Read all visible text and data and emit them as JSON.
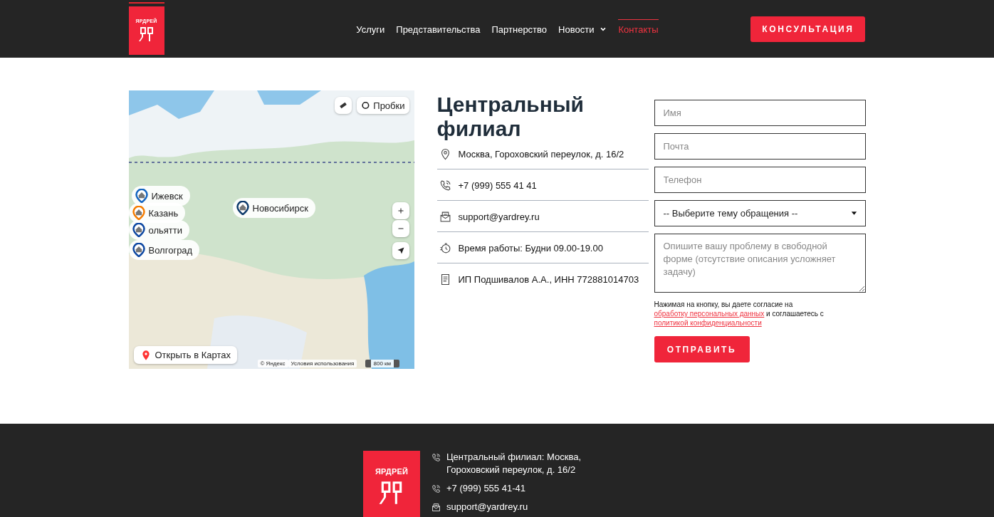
{
  "header": {
    "logo": {
      "text": "ЯРДРЕЙ"
    },
    "nav": [
      {
        "label": "Услуги",
        "selected": false,
        "kind": "link"
      },
      {
        "label": "Представительства",
        "selected": false,
        "kind": "link"
      },
      {
        "label": "Партнерство",
        "selected": false,
        "kind": "link"
      },
      {
        "label": "Новости",
        "selected": false,
        "kind": "dropdown"
      },
      {
        "label": "Контакты",
        "selected": true,
        "kind": "link"
      }
    ],
    "cta": "КОНСУЛЬТАЦИЯ"
  },
  "map": {
    "traffic_button": "Пробки",
    "open_button": "Открыть в Картах",
    "copyright": "© Яндекс",
    "terms": "Условия использования",
    "scale": "800 км",
    "pins": [
      {
        "label": "Ижевск",
        "color": "#1565c0"
      },
      {
        "label": "Казань",
        "color": "#f57c00"
      },
      {
        "label": "ольятти",
        "color": "#0d47a1"
      },
      {
        "label": "Волгоград",
        "color": "#0d47a1"
      },
      {
        "label": "Новосибирск",
        "color": "#0d3a6b"
      }
    ]
  },
  "branch": {
    "title": "Центральный филиал",
    "rows": [
      {
        "kind": "address",
        "text": "Москва, Гороховский переулок, д. 16/2"
      },
      {
        "kind": "phone",
        "text": "+7 (999) 555 41 41"
      },
      {
        "kind": "email",
        "text": "support@yardrey.ru"
      },
      {
        "kind": "hours",
        "text": "Время работы: Будни 09.00-19.00"
      },
      {
        "kind": "document",
        "text": "ИП Подшивалов А.А., ИНН 772881014703"
      }
    ]
  },
  "form": {
    "fields": [
      {
        "kind": "input",
        "placeholder": "Имя"
      },
      {
        "kind": "input",
        "placeholder": "Почта"
      },
      {
        "kind": "input",
        "placeholder": "Телефон"
      },
      {
        "kind": "select",
        "value": "-- Выберите тему обращения --"
      },
      {
        "kind": "textarea",
        "placeholder": "Опишите вашу проблему в свободной форме (отсутствие описания усложняет задачу)"
      }
    ],
    "consent": [
      {
        "kind": "text",
        "text": "Нажимая на кнопку, вы даете согласие на "
      },
      {
        "kind": "link",
        "text": "обработку персональных данных"
      },
      {
        "kind": "text",
        "text": " и соглашаетесь с "
      },
      {
        "kind": "link",
        "text": "политикой конфиденциальности"
      }
    ],
    "submit": "ОТПРАВИТЬ"
  },
  "footer": {
    "logo": {
      "text": "ЯРДРЕЙ"
    },
    "contacts": [
      {
        "kind": "phone",
        "text": "Центральный филиал: Москва, Гороховский переулок, д. 16/2"
      },
      {
        "kind": "phone",
        "text": "+7 (999) 555 41-41"
      },
      {
        "kind": "email",
        "text": "support@yardrey.ru"
      }
    ]
  }
}
